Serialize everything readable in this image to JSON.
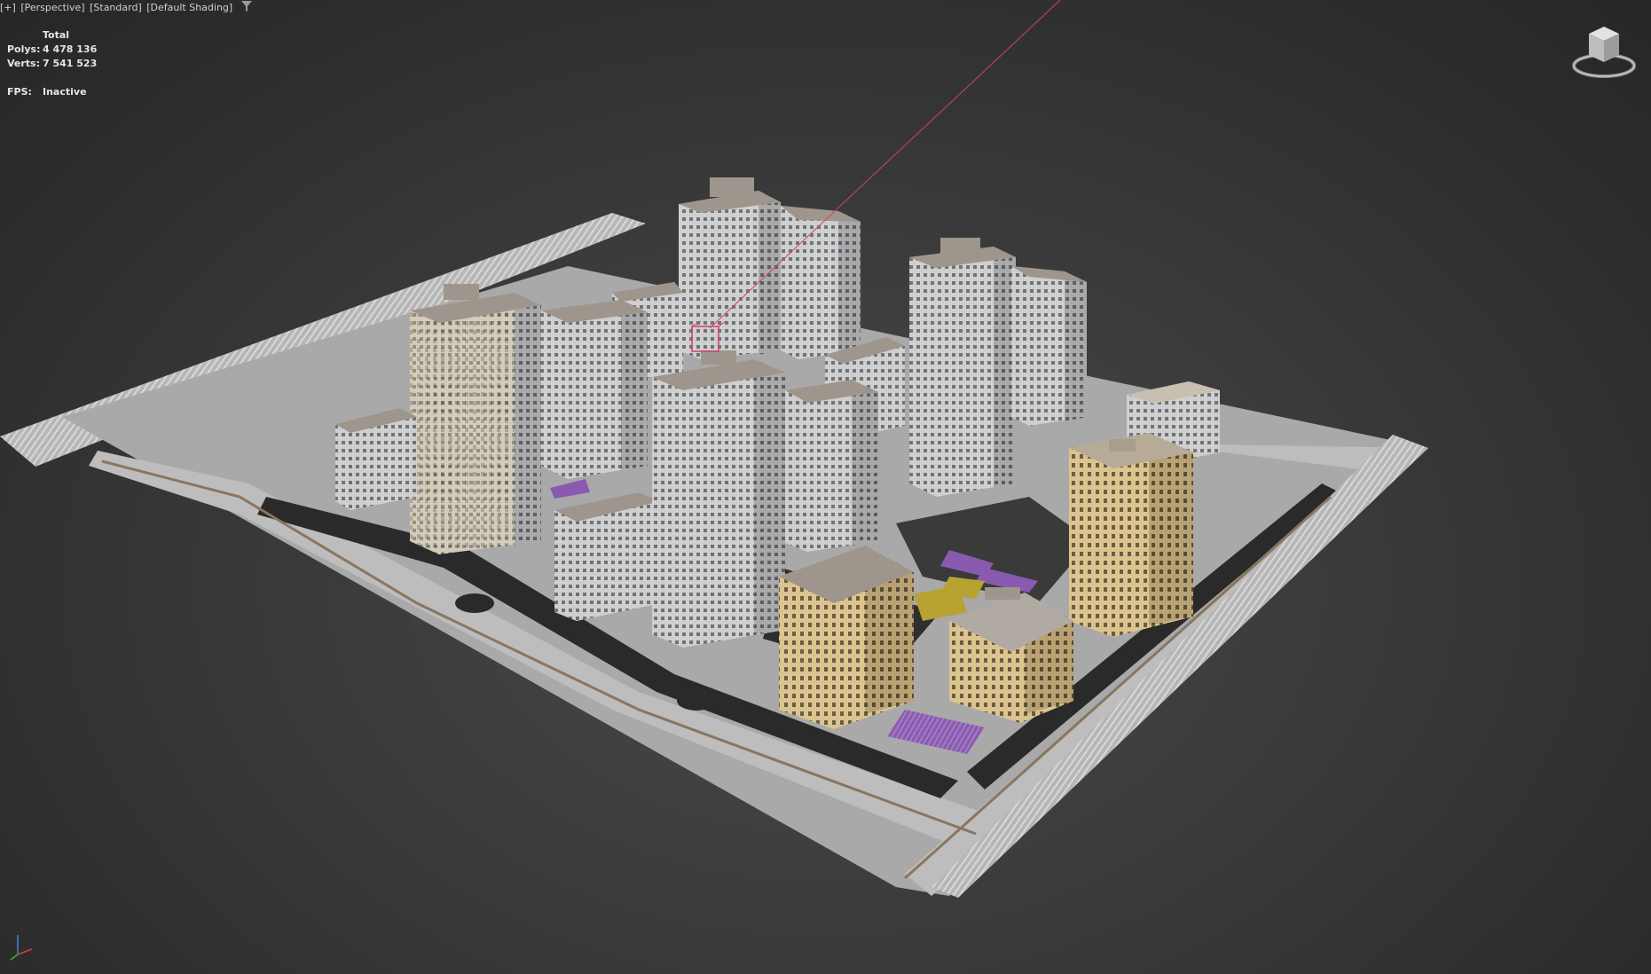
{
  "viewport": {
    "plus_label": "[+]",
    "view_label": "[Perspective]",
    "mode_label": "[Standard]",
    "shading_label": "[Default Shading]",
    "filter_icon": "funnel-icon"
  },
  "stats": {
    "header": "Total",
    "polys_label": "Polys:",
    "polys_value": "4 478 136",
    "verts_label": "Verts:",
    "verts_value": "7 541 523",
    "fps_label": "FPS:",
    "fps_value": "Inactive"
  },
  "icons": {
    "viewcube": "viewcube-icon",
    "axis": "axis-tripod-icon"
  },
  "colors": {
    "background": "#3a3a3a",
    "road": "#b4b4b4",
    "building_grey": "#c6c6c6",
    "building_tan": "#d9c28a",
    "roof": "#9e968c",
    "playground_purple": "#8a5ab0",
    "playground_yellow": "#b8a230",
    "selection_red": "#d0406a"
  }
}
